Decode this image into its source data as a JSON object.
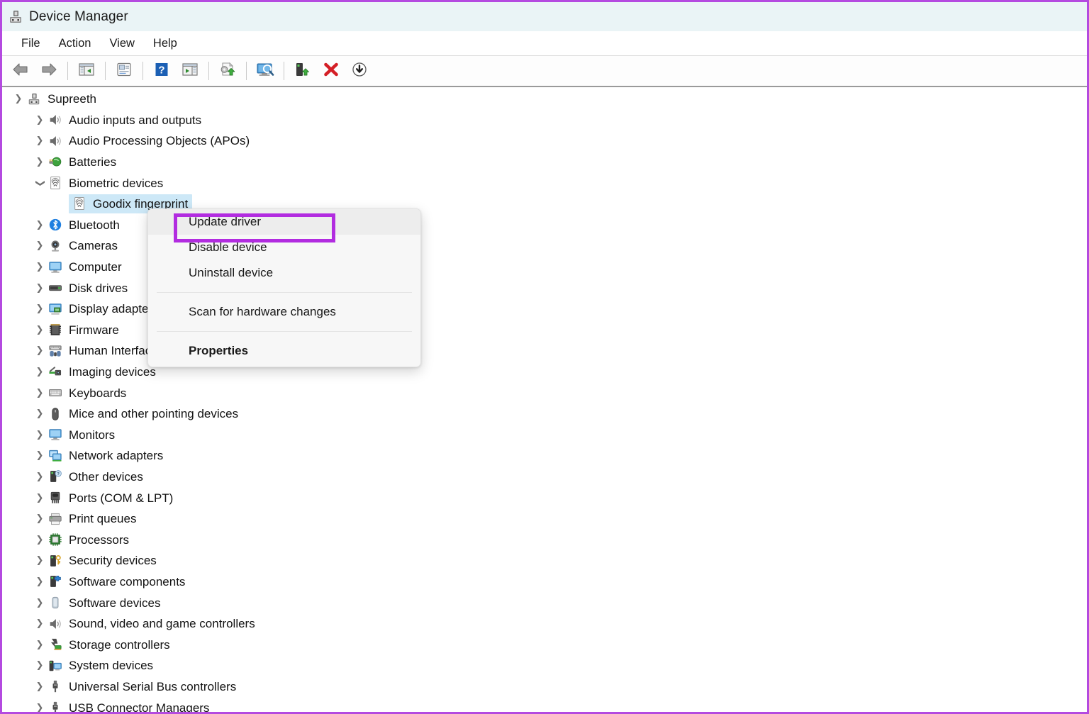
{
  "window": {
    "title": "Device Manager",
    "title_icon": "device-manager-icon",
    "annotation_color": "#b22ce0",
    "border_color": "#b44ae0",
    "titlebar_bg": "#eaf4f6"
  },
  "menubar": {
    "items": [
      {
        "label": "File",
        "name": "menu-file"
      },
      {
        "label": "Action",
        "name": "menu-action"
      },
      {
        "label": "View",
        "name": "menu-view"
      },
      {
        "label": "Help",
        "name": "menu-help"
      }
    ]
  },
  "toolbar": {
    "buttons": [
      {
        "icon": "back-arrow-icon",
        "name": "toolbar-back"
      },
      {
        "icon": "forward-arrow-icon",
        "name": "toolbar-forward"
      },
      {
        "sep": true
      },
      {
        "icon": "show-hide-console-tree-icon",
        "name": "toolbar-console-tree"
      },
      {
        "sep": true
      },
      {
        "icon": "properties-icon",
        "name": "toolbar-properties"
      },
      {
        "sep": true
      },
      {
        "icon": "help-icon",
        "name": "toolbar-help"
      },
      {
        "icon": "show-hide-action-pane-icon",
        "name": "toolbar-action-pane"
      },
      {
        "sep": true
      },
      {
        "icon": "update-driver-icon",
        "name": "toolbar-update-driver"
      },
      {
        "sep": true
      },
      {
        "icon": "scan-for-hardware-changes-icon",
        "name": "toolbar-scan-hardware"
      },
      {
        "sep": true
      },
      {
        "icon": "add-legacy-hardware-icon",
        "name": "toolbar-add-device"
      },
      {
        "icon": "uninstall-device-icon",
        "name": "toolbar-uninstall-device"
      },
      {
        "icon": "disable-device-icon",
        "name": "toolbar-disable-device"
      }
    ]
  },
  "tree": {
    "root": {
      "label": "Supreeth",
      "icon": "computer-device-icon",
      "expanded": true
    },
    "items": [
      {
        "label": "Audio inputs and outputs",
        "icon": "speaker-icon",
        "indent": 1,
        "expanded": false
      },
      {
        "label": "Audio Processing Objects (APOs)",
        "icon": "speaker-icon",
        "indent": 1,
        "expanded": false
      },
      {
        "label": "Batteries",
        "icon": "battery-icon",
        "indent": 1,
        "expanded": false
      },
      {
        "label": "Biometric devices",
        "icon": "fingerprint-icon",
        "indent": 1,
        "expanded": true
      },
      {
        "label": "Goodix fingerprint",
        "icon": "fingerprint-icon",
        "indent": 2,
        "leaf": true,
        "selected": true
      },
      {
        "label": "Bluetooth",
        "icon": "bluetooth-icon",
        "indent": 1,
        "expanded": false
      },
      {
        "label": "Cameras",
        "icon": "camera-icon",
        "indent": 1,
        "expanded": false
      },
      {
        "label": "Computer",
        "icon": "monitor-icon",
        "indent": 1,
        "expanded": false
      },
      {
        "label": "Disk drives",
        "icon": "disk-drive-icon",
        "indent": 1,
        "expanded": false
      },
      {
        "label": "Display adapters",
        "icon": "display-adapter-icon",
        "indent": 1,
        "expanded": false
      },
      {
        "label": "Firmware",
        "icon": "firmware-chip-icon",
        "indent": 1,
        "expanded": false
      },
      {
        "label": "Human Interface Devices",
        "icon": "hid-icon",
        "indent": 1,
        "expanded": false
      },
      {
        "label": "Imaging devices",
        "icon": "imaging-device-icon",
        "indent": 1,
        "expanded": false
      },
      {
        "label": "Keyboards",
        "icon": "keyboard-icon",
        "indent": 1,
        "expanded": false
      },
      {
        "label": "Mice and other pointing devices",
        "icon": "mouse-icon",
        "indent": 1,
        "expanded": false
      },
      {
        "label": "Monitors",
        "icon": "monitor-icon",
        "indent": 1,
        "expanded": false
      },
      {
        "label": "Network adapters",
        "icon": "network-adapter-icon",
        "indent": 1,
        "expanded": false
      },
      {
        "label": "Other devices",
        "icon": "other-device-icon",
        "indent": 1,
        "expanded": false
      },
      {
        "label": "Ports (COM & LPT)",
        "icon": "port-icon",
        "indent": 1,
        "expanded": false
      },
      {
        "label": "Print queues",
        "icon": "printer-icon",
        "indent": 1,
        "expanded": false
      },
      {
        "label": "Processors",
        "icon": "processor-icon",
        "indent": 1,
        "expanded": false
      },
      {
        "label": "Security devices",
        "icon": "security-device-icon",
        "indent": 1,
        "expanded": false
      },
      {
        "label": "Software components",
        "icon": "software-component-icon",
        "indent": 1,
        "expanded": false
      },
      {
        "label": "Software devices",
        "icon": "software-device-icon",
        "indent": 1,
        "expanded": false
      },
      {
        "label": "Sound, video and game controllers",
        "icon": "speaker-icon",
        "indent": 1,
        "expanded": false
      },
      {
        "label": "Storage controllers",
        "icon": "storage-controller-icon",
        "indent": 1,
        "expanded": false
      },
      {
        "label": "System devices",
        "icon": "system-device-icon",
        "indent": 1,
        "expanded": false
      },
      {
        "label": "Universal Serial Bus controllers",
        "icon": "usb-icon",
        "indent": 1,
        "expanded": false
      },
      {
        "label": "USB Connector Managers",
        "icon": "usb-icon",
        "indent": 1,
        "expanded": false
      }
    ]
  },
  "context_menu": {
    "items": [
      {
        "label": "Update driver",
        "name": "ctx-update-driver",
        "highlighted": true
      },
      {
        "label": "Disable device",
        "name": "ctx-disable-device"
      },
      {
        "label": "Uninstall device",
        "name": "ctx-uninstall-device"
      },
      {
        "separator": true
      },
      {
        "label": "Scan for hardware changes",
        "name": "ctx-scan-hardware-changes"
      },
      {
        "separator": true
      },
      {
        "label": "Properties",
        "name": "ctx-properties",
        "bold": true
      }
    ]
  }
}
